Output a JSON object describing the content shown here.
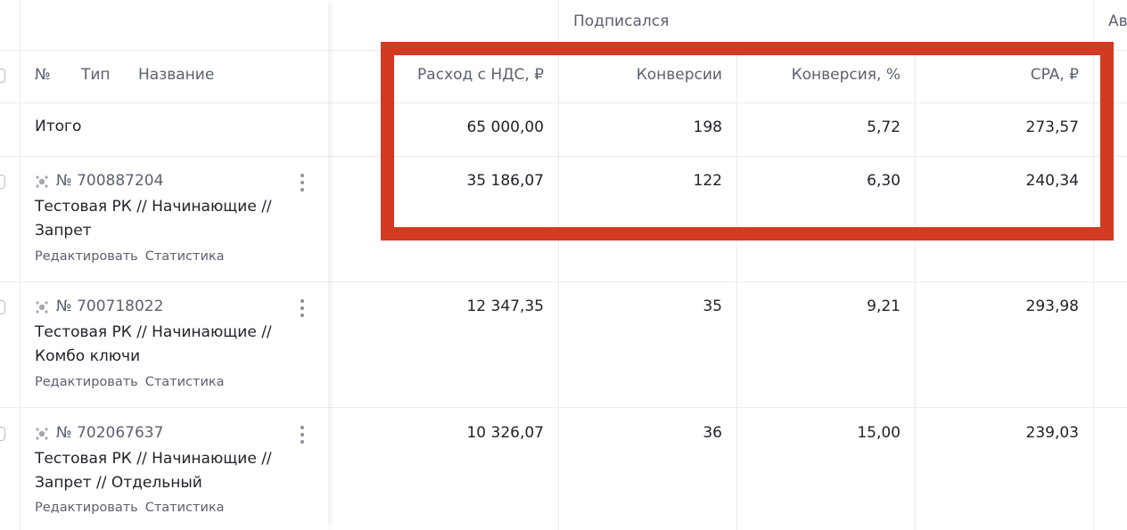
{
  "columns_left": {
    "number": "№",
    "type": "Тип",
    "name": "Название"
  },
  "group_title": "Подписался",
  "next_group_partial": "Ав",
  "metric_headers": [
    "Расход с НДС, ₽",
    "Конверсии",
    "Конверсия, %",
    "CPA, ₽"
  ],
  "total": {
    "label": "Итого",
    "values": [
      "65 000,00",
      "198",
      "5,72",
      "273,57"
    ]
  },
  "rows": [
    {
      "id": "№ 700887204",
      "name": "Тестовая РК // Начинающие // Запрет",
      "edit_label": "Редактировать",
      "stats_label": "Статистика",
      "values": [
        "35 186,07",
        "122",
        "6,30",
        "240,34"
      ]
    },
    {
      "id": "№ 700718022",
      "name": "Тестовая РК // Начинающие // Комбо ключи",
      "edit_label": "Редактировать",
      "stats_label": "Статистика",
      "values": [
        "12 347,35",
        "35",
        "9,21",
        "293,98"
      ]
    },
    {
      "id": "№ 702067637",
      "name": "Тестовая РК // Начинающие // Запрет // Отдельный",
      "edit_label": "Редактировать",
      "stats_label": "Статистика",
      "values": [
        "10 326,07",
        "36",
        "15,00",
        "239,03"
      ]
    }
  ],
  "icons": {
    "campaign_type": "campaign-type-icon",
    "row_menu": "more-vertical-icon"
  },
  "colors": {
    "highlight": "#d23a22",
    "text_primary": "#21232b",
    "text_secondary": "#5c6070"
  }
}
